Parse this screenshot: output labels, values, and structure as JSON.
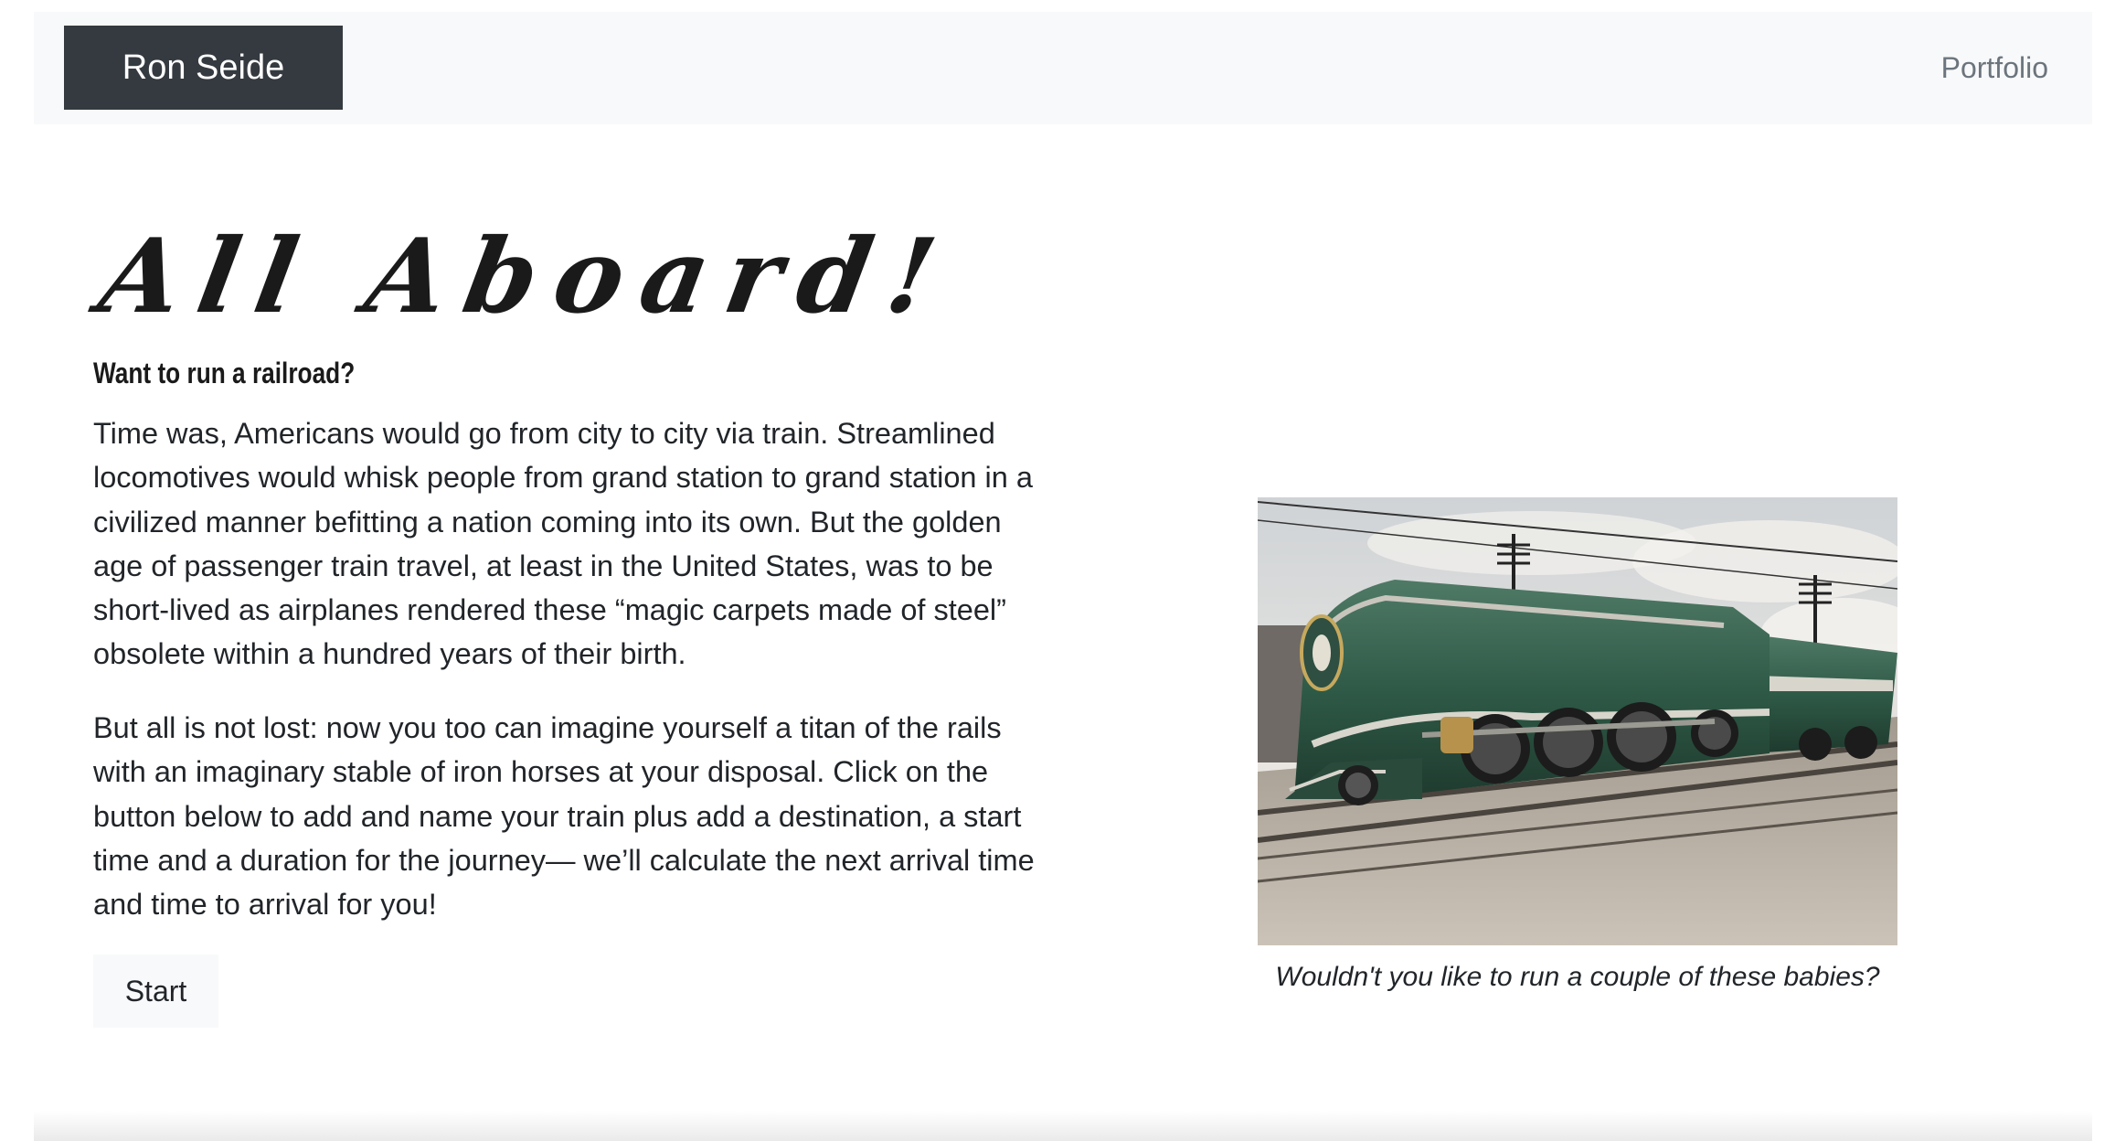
{
  "navbar": {
    "brand": "Ron Seide",
    "links": [
      "Portfolio"
    ]
  },
  "hero": {
    "title": "All Aboard!",
    "subtitle": "Want to run a railroad?",
    "paragraphs": [
      "Time was, Americans would go from city to city via train. Streamlined locomotives would whisk people from grand station to grand station in a civilized manner befitting a nation coming into its own. But the golden age of passenger train travel, at least in the United States, was to be short-lived as airplanes rendered these “magic carpets made of steel” obsolete within a hundred years of their birth.",
      "But all is not lost: now you too can imagine yourself a titan of the rails with an imaginary stable of iron horses at your disposal. Click on the button below to add and name your train plus add a destination, a start time and a duration for the journey— we’ll calculate the next arrival time and time to arrival for you!"
    ],
    "start_label": "Start"
  },
  "figure": {
    "caption": "Wouldn't you like to run a couple of these babies?"
  },
  "colors": {
    "navbar_bg": "#f8f9fa",
    "brand_bg": "#343a40",
    "brand_text": "#ffffff",
    "nav_link": "#6c757d",
    "train_green": "#2f5a47"
  }
}
